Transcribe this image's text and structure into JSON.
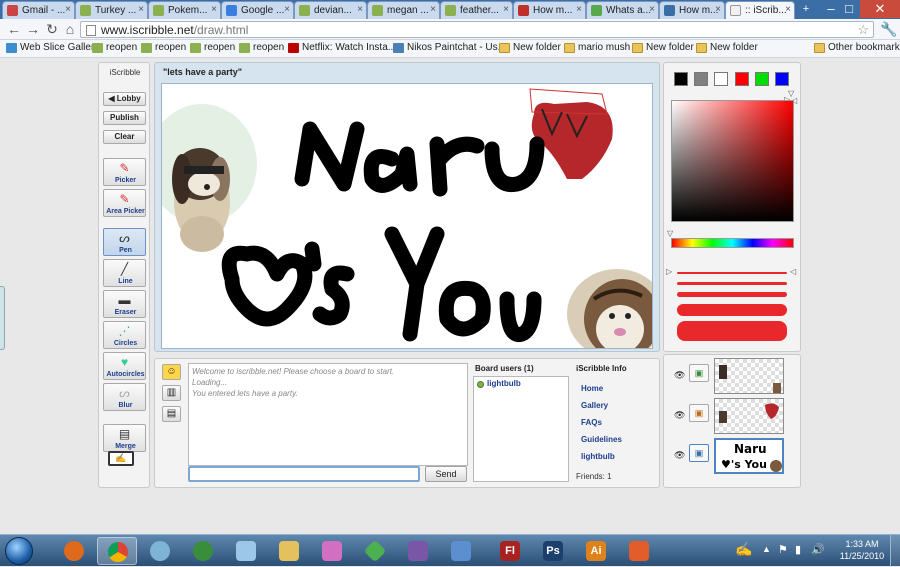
{
  "browser": {
    "tabs": [
      {
        "label": "Gmail - ...",
        "favicon_color": "#c44"
      },
      {
        "label": "Turkey ...",
        "favicon_color": "#8bb050"
      },
      {
        "label": "Pokem...",
        "favicon_color": "#8bb050"
      },
      {
        "label": "Google ...",
        "favicon_color": "#3b7de0"
      },
      {
        "label": "devian...",
        "favicon_color": "#8bb050"
      },
      {
        "label": "megan ...",
        "favicon_color": "#8bb050"
      },
      {
        "label": "feather...",
        "favicon_color": "#8bb050"
      },
      {
        "label": "How m...",
        "favicon_color": "#c0302a"
      },
      {
        "label": "Whats a...",
        "favicon_color": "#59a84b"
      },
      {
        "label": "How m...",
        "favicon_color": "#3b6ea5"
      },
      {
        "label": ":: iScrib...",
        "favicon_color": "#f0f0f0"
      }
    ],
    "url_domain": "www.iscribble.net",
    "url_path": "/draw.html",
    "bookmarks": [
      {
        "label": "Web Slice Gallery",
        "icon": "web-slice-icon"
      },
      {
        "label": "reopen",
        "icon": "page-icon"
      },
      {
        "label": "reopen",
        "icon": "page-icon"
      },
      {
        "label": "reopen",
        "icon": "page-icon"
      },
      {
        "label": "reopen",
        "icon": "page-icon"
      },
      {
        "label": "Netflix: Watch Insta...",
        "icon": "netflix-icon"
      },
      {
        "label": "Nikos Paintchat - Us...",
        "icon": "bird-icon"
      },
      {
        "label": "New folder",
        "icon": "folder-icon"
      },
      {
        "label": "mario mush",
        "icon": "folder-icon"
      },
      {
        "label": "New folder",
        "icon": "folder-icon"
      },
      {
        "label": "New folder",
        "icon": "folder-icon"
      },
      {
        "label": "Other bookmarks",
        "icon": "folder-icon"
      }
    ]
  },
  "app": {
    "brand": "iScribble",
    "board_title": "\"lets have a party\"",
    "buttons": {
      "lobby": "◀ Lobby",
      "publish": "Publish",
      "clear": "Clear"
    },
    "tools": [
      {
        "label": "Picker",
        "icon": "picker-icon"
      },
      {
        "label": "Area Picker",
        "icon": "area-picker-icon"
      },
      {
        "label": "Pen",
        "icon": "pen-icon",
        "selected": true
      },
      {
        "label": "Line",
        "icon": "line-icon"
      },
      {
        "label": "Eraser",
        "icon": "eraser-icon"
      },
      {
        "label": "Circles",
        "icon": "circles-icon"
      },
      {
        "label": "Autocircles",
        "icon": "autocircles-icon"
      },
      {
        "label": "Blur",
        "icon": "blur-icon"
      },
      {
        "label": "Merge",
        "icon": "merge-icon"
      }
    ],
    "canvas_text": {
      "line1": "Naru",
      "line2": "♥'s You"
    },
    "chat": {
      "messages": [
        "Welcome to iscribble.net! Please choose a board to start.",
        "Loading...",
        "You entered lets have a party."
      ],
      "input_value": "",
      "send_label": "Send"
    },
    "board_users": {
      "heading": "Board users (1)",
      "users": [
        "lightbulb"
      ]
    },
    "info": {
      "heading": "iScribble Info",
      "links": [
        "Home",
        "Gallery",
        "FAQs",
        "Guidelines",
        "lightbulb"
      ],
      "friends": "Friends: 1"
    },
    "swatches": [
      "#000000",
      "#808080",
      "#ffffff",
      "#ff0000",
      "#00dd00",
      "#0000ff"
    ],
    "selected_color": "#ff0000",
    "layers": [
      {
        "name": "layer-1",
        "active": false
      },
      {
        "name": "layer-2",
        "active": false
      },
      {
        "name": "layer-3",
        "active": true
      }
    ]
  },
  "taskbar": {
    "time": "1:33 AM",
    "date": "11/25/2010",
    "apps": [
      {
        "icon": "firefox-icon",
        "color": "#e06a1b"
      },
      {
        "icon": "chrome-icon",
        "color": "#3b7de0",
        "open": true
      },
      {
        "icon": "paint-icon",
        "color": "#7fb3d6"
      },
      {
        "icon": "media-player-icon",
        "color": "#3a8d3a"
      },
      {
        "icon": "notepad-icon",
        "color": "#9cc7e8"
      },
      {
        "icon": "explorer-icon",
        "color": "#e4c15d"
      },
      {
        "icon": "puzzle-icon",
        "color": "#d36fc1"
      },
      {
        "icon": "sims-icon",
        "color": "#4caf50"
      },
      {
        "icon": "game-icon",
        "color": "#7a57a6"
      },
      {
        "icon": "network-icon",
        "color": "#5b8fcf"
      },
      {
        "icon": "flash-icon",
        "color": "#a8231f",
        "text": "Fl"
      },
      {
        "icon": "photoshop-icon",
        "color": "#1c3f6e",
        "text": "Ps"
      },
      {
        "icon": "illustrator-icon",
        "color": "#e0821a",
        "text": "Ai"
      },
      {
        "icon": "presentation-icon",
        "color": "#e35d2a"
      }
    ]
  }
}
